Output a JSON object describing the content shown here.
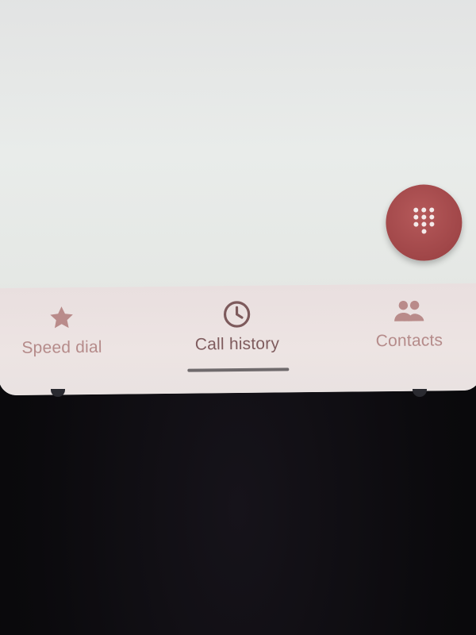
{
  "dialer": {
    "fab_icon": "dialpad-icon",
    "accent_color": "#a34749"
  },
  "bottom_nav": {
    "items": [
      {
        "label": "Speed dial",
        "icon": "star-icon",
        "active": false
      },
      {
        "label": "Call history",
        "icon": "clock-icon",
        "active": true
      },
      {
        "label": "Contacts",
        "icon": "people-icon",
        "active": false
      }
    ]
  }
}
